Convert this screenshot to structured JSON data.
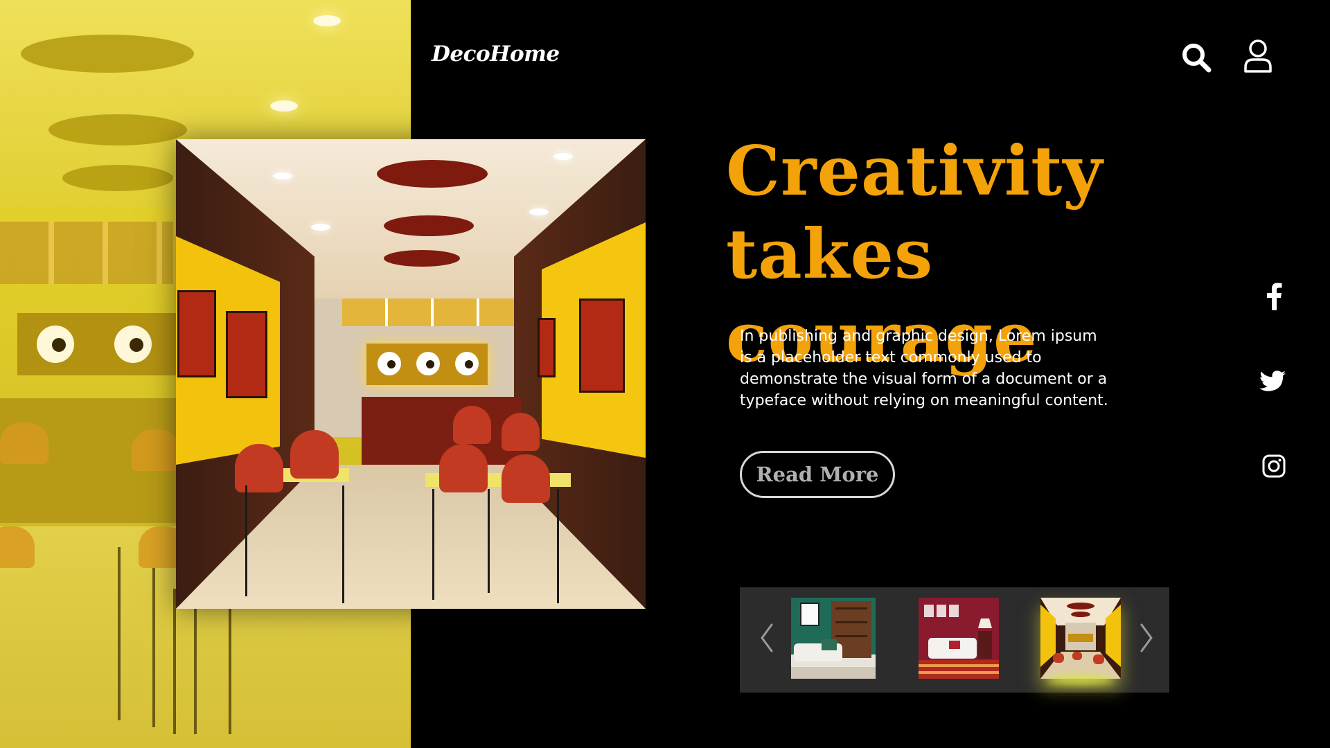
{
  "header": {
    "logo": "DecoHome",
    "search_icon": "search-icon",
    "user_icon": "user-icon"
  },
  "hero": {
    "headline_line1": "Creativity",
    "headline_line2": "takes courage",
    "description": "In publishing and graphic design, Lorem ipsum is a placeholder text commonly used to demonstrate the visual form of a document or a typeface without relying on meaningful content.",
    "cta_label": "Read More"
  },
  "social": [
    {
      "name": "facebook-icon"
    },
    {
      "name": "twitter-icon"
    },
    {
      "name": "instagram-icon"
    }
  ],
  "carousel": {
    "prev_icon": "chevron-left-icon",
    "next_icon": "chevron-right-icon",
    "thumbnails": [
      {
        "theme": "green living room"
      },
      {
        "theme": "red living room"
      },
      {
        "theme": "yellow restaurant",
        "selected": true
      }
    ]
  },
  "colors": {
    "background": "#000000",
    "accent": "#f4a20a",
    "carousel_bg": "#2c2c2c",
    "text": "#ffffff",
    "button_text": "#b0b0b0"
  }
}
